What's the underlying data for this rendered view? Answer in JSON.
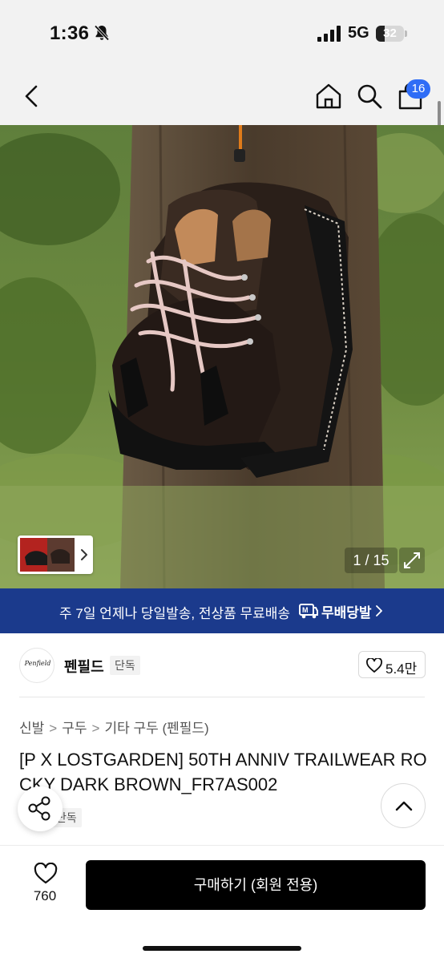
{
  "status_bar": {
    "time": "1:36",
    "network": "5G",
    "battery": "32",
    "battery_level": 0.32,
    "icons": [
      "bell-slash-icon",
      "signal-icon",
      "battery-icon"
    ]
  },
  "header": {
    "icons": [
      "back-arrow-icon",
      "home-icon",
      "search-icon",
      "cart-icon"
    ],
    "cart_count": "16"
  },
  "hero": {
    "counter": "1 / 15",
    "icons": [
      "chevron-right-icon",
      "expand-icon"
    ]
  },
  "promo": {
    "text": "주 7일 언제나 당일발송, 전상품 무료배송",
    "brand": "무배당발",
    "icons": [
      "delivery-icon",
      "chevron-right-icon"
    ]
  },
  "brand": {
    "logo_text": "Penfield",
    "name": "펜필드",
    "tag": "단독",
    "likes": "5.4만"
  },
  "breadcrumb": [
    "신발",
    "구두",
    "기타 구두 (펜필드)"
  ],
  "product": {
    "title": "[P X LOSTGARDEN] 50TH ANNIV TRAILWEAR ROCKY DARK BROWN_FR7AS002",
    "exclusive_tag": "단독"
  },
  "bottom_bar": {
    "wish_count": "760",
    "buy_label": "구매하기 (회원 전용)"
  },
  "colors": {
    "accent_blue": "#2f6df6",
    "promo_bg": "#1b3a8c",
    "buy_bg": "#000000"
  }
}
